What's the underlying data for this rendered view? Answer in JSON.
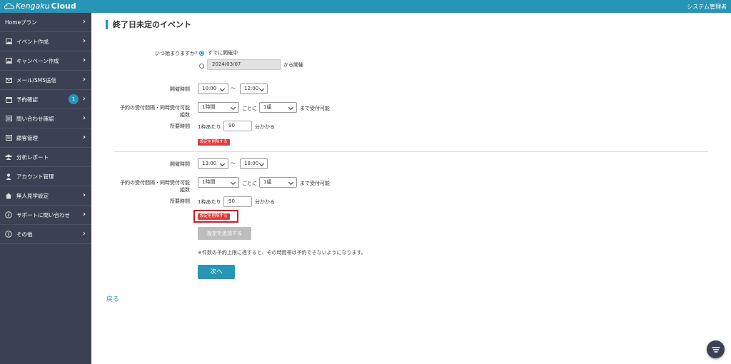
{
  "header": {
    "logo_part1": "Kengaku",
    "logo_part2": "Cloud",
    "user": "システム管理者"
  },
  "sidebar": {
    "items": [
      {
        "label": "Homeプラン",
        "icon": "",
        "chevron": true
      },
      {
        "label": "イベント作成",
        "icon": "image-icon",
        "chevron": true
      },
      {
        "label": "キャンペーン作成",
        "icon": "image-icon",
        "chevron": true
      },
      {
        "label": "メール/SMS送信",
        "icon": "mail-icon",
        "chevron": true
      },
      {
        "label": "予約確認",
        "icon": "calendar-icon",
        "chevron": true,
        "badge": "1"
      },
      {
        "label": "問い合わせ確認",
        "icon": "list-icon",
        "chevron": true
      },
      {
        "label": "顧客管理",
        "icon": "list-icon",
        "chevron": true
      },
      {
        "label": "分析レポート",
        "icon": "users-icon",
        "chevron": false
      },
      {
        "label": "アカウント管理",
        "icon": "user-icon",
        "chevron": false
      },
      {
        "label": "無人見学設定",
        "icon": "home-icon",
        "chevron": true
      },
      {
        "label": "サポートに問い合わせ",
        "icon": "info-icon",
        "chevron": true
      },
      {
        "label": "その他",
        "icon": "info-icon",
        "chevron": true
      }
    ]
  },
  "page": {
    "title": "終了日未定のイベント",
    "start_label": "いつ始まりますか？",
    "radio_already": "すでに開催中",
    "date_value": "2024/03/07",
    "date_suffix": "から開催",
    "blocks": [
      {
        "time_label": "開催時間",
        "start_time": "10:00",
        "tilde": "〜",
        "end_time": "12:00",
        "interval_label_1": "予約の受付間隔・同時受付可能",
        "interval_label_2": "組数",
        "interval_value": "1時間",
        "per_text": "ごとに",
        "groups_value": "1組",
        "accept_text": "まで受付可能",
        "duration_label": "所要時間",
        "per_slot_text": "1枠あたり",
        "duration_value": "90",
        "duration_suffix": "分かかる",
        "delete_label": "設定を削除する"
      },
      {
        "time_label": "開催時間",
        "start_time": "13:00",
        "tilde": "〜",
        "end_time": "18:00",
        "interval_label_1": "予約の受付間隔・同時受付可能",
        "interval_label_2": "組数",
        "interval_value": "1時間",
        "per_text": "ごとに",
        "groups_value": "1組",
        "accept_text": "まで受付可能",
        "duration_label": "所要時間",
        "per_slot_text": "1枠あたり",
        "duration_value": "90",
        "duration_suffix": "分かかる",
        "delete_label": "設定を削除する"
      }
    ],
    "add_label": "設定を追加する",
    "note": "※件数の予約上限に達すると、その時間帯は予約できないようになります。",
    "next_label": "次へ",
    "back_label": "戻る"
  },
  "colors": {
    "brand": "#2795b6",
    "sidebar_bg": "#3b4152",
    "delete_red": "#e23a3a",
    "highlight_red": "#e0141e",
    "link_blue": "#2a8fd0"
  }
}
